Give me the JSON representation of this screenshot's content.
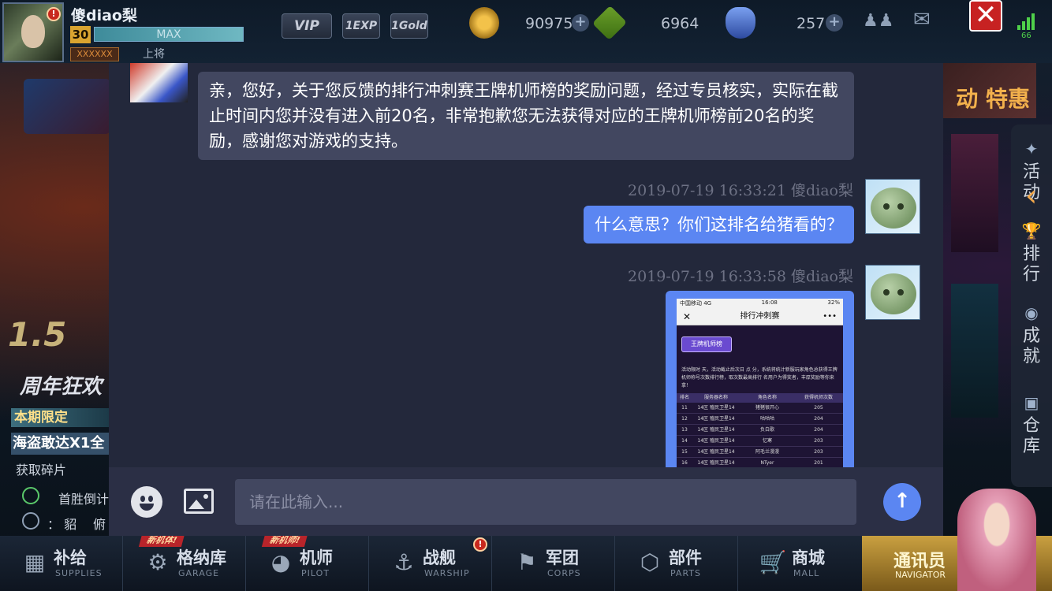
{
  "player": {
    "name": "傻diao梨",
    "level": "30",
    "xp_label": "MAX",
    "rank_title": "上将",
    "rank_box": "XXXXXX"
  },
  "top_badges": {
    "vip": "VIP",
    "exp": "1EXP",
    "gold": "1Gold"
  },
  "resources": {
    "gold": "90975",
    "chips": "6964",
    "crystals": "257"
  },
  "signal_value": "66",
  "left_panel": {
    "anniversary": "1.5",
    "anniversary_sub": "周年狂欢",
    "limited_label": "本期限定",
    "limited_name": "海盗敢达X1全",
    "get_fragments": "获取碎片",
    "first_win": "首胜倒计",
    "server_prefix": "： 貂",
    "server_suffix": "俯"
  },
  "right_panel": {
    "promo": "动 特惠",
    "menu": [
      {
        "label": "活\n动",
        "icon": "activity-icon"
      },
      {
        "label": "排\n行",
        "icon": "trophy-icon"
      },
      {
        "label": "成\n就",
        "icon": "medal-icon"
      },
      {
        "label": "仓\n库",
        "icon": "warehouse-icon"
      }
    ]
  },
  "chat": {
    "support_message": "亲，您好，关于您反馈的排行冲刺赛王牌机师榜的奖励问题，经过专员核实，实际在截止时间内您并没有进入前20名，非常抱歉您无法获得对应的王牌机师榜前20名的奖励，感谢您对游戏的支持。",
    "messages": [
      {
        "time": "2019-07-19 16:33:21",
        "sender": "傻diao梨",
        "text": "什么意思？你们这排名给猪看的？"
      },
      {
        "time": "2019-07-19 16:33:58",
        "sender": "傻diao梨",
        "text": ""
      }
    ],
    "screenshot": {
      "carrier": "中国移动  4G",
      "clock": "16:08",
      "battery": "32%",
      "title": "排行冲刺赛",
      "button": "王牌机师榜",
      "description": "活动限时 天，活动截止后次日 点 分，系统将统计新服玩家角色总获得王牌机师称号次数排行榜，取次数最高排行 名用户为得奖者，丰厚奖励等你来拿！",
      "headers": [
        "排名",
        "服务器名称",
        "角色名称",
        "获得机师次数"
      ],
      "rows": [
        [
          "11",
          "14区 殖民卫星14",
          "猪猪很开心",
          "205"
        ],
        [
          "12",
          "14区 殖民卫星14",
          "咕咕咕",
          "204"
        ],
        [
          "13",
          "14区 殖民卫星14",
          "负白歌",
          "204"
        ],
        [
          "14",
          "14区 殖民卫星14",
          "忆寒",
          "203"
        ],
        [
          "15",
          "14区 殖民卫星14",
          "阿毛兰漫漫",
          "203"
        ],
        [
          "16",
          "14区 殖民卫星14",
          "NTyer",
          "201"
        ]
      ]
    },
    "input_placeholder": "请在此输入..."
  },
  "bottom_nav": [
    {
      "label": "补给",
      "sub": "SUPPLIES",
      "icon": "supplies-icon",
      "tag": ""
    },
    {
      "label": "格纳库",
      "sub": "GARAGE",
      "icon": "garage-icon",
      "tag": "新机体!"
    },
    {
      "label": "机师",
      "sub": "PILOT",
      "icon": "pilot-icon",
      "tag": "新机师!"
    },
    {
      "label": "战舰",
      "sub": "WARSHIP",
      "icon": "warship-icon",
      "tag": ""
    },
    {
      "label": "军团",
      "sub": "CORPS",
      "icon": "corps-icon",
      "tag": ""
    },
    {
      "label": "部件",
      "sub": "PARTS",
      "icon": "parts-icon",
      "tag": ""
    },
    {
      "label": "商城",
      "sub": "MALL",
      "icon": "mall-icon",
      "tag": ""
    }
  ],
  "navigator": {
    "label": "通讯员",
    "sub": "NAVIGATOR"
  },
  "colors": {
    "accent": "#5b86f2",
    "panel": "#23283b",
    "bubble_in": "#424760",
    "close": "#c72222"
  }
}
